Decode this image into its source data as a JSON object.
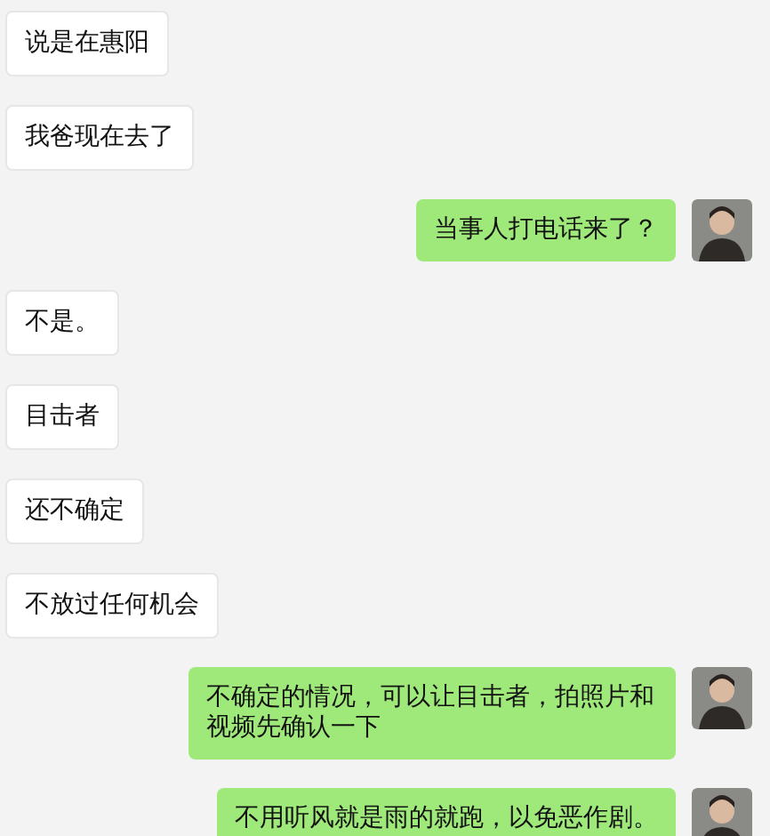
{
  "messages": [
    {
      "kind": "received",
      "text": "说是在惠阳"
    },
    {
      "kind": "received",
      "text": "我爸现在去了"
    },
    {
      "kind": "sent",
      "text": "当事人打电话来了？"
    },
    {
      "kind": "received",
      "text": "不是。"
    },
    {
      "kind": "received",
      "text": "目击者"
    },
    {
      "kind": "received",
      "text": "还不确定"
    },
    {
      "kind": "received",
      "text": "不放过任何机会"
    },
    {
      "kind": "sent",
      "text": "不确定的情况，可以让目击者，拍照片和视频先确认一下"
    },
    {
      "kind": "sent",
      "text": "不用听风就是雨的就跑，以免恶作剧。"
    }
  ]
}
